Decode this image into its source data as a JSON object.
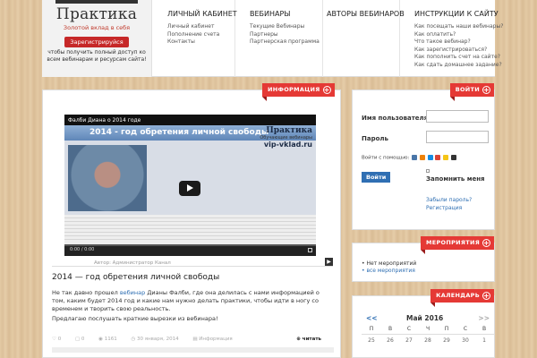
{
  "header": {
    "logo_title": "Практика",
    "logo_subtitle": "Золотой вклад в себя",
    "register_button": "Зарегистрируйся",
    "register_note": "чтобы получить полный доступ ко всем вебинарам и ресурсам сайта!",
    "nav": [
      {
        "title": "ЛИЧНЫЙ КАБИНЕТ",
        "links": [
          "Личный кабинет",
          "Пополнение счета",
          "Контакты"
        ]
      },
      {
        "title": "ВЕБИНАРЫ",
        "links": [
          "Текущие Вебинары",
          "Партнеры",
          "Партнерская программа"
        ]
      },
      {
        "title": "АВТОРЫ ВЕБИНАРОВ",
        "links": []
      },
      {
        "title": "ИНСТРУКЦИИ К САЙТУ",
        "links": [
          "Как посещать наши вебинары?",
          "Как оплатить?",
          "Что такое вебинар?",
          "Как зарегистрироваться?",
          "Как пополнить счет на сайте?",
          "Как сдать домашнее задание?"
        ]
      }
    ]
  },
  "post": {
    "ribbon": "ИНФОРМАЦИЯ",
    "video_title": "Фалби Диана о 2014 годе",
    "slide_heading": "2014 - год обретения личной свободы",
    "slide_brand": "Практика",
    "slide_brand_sub": "Обучающие вебинары",
    "slide_brand_url": "vip-vklad.ru",
    "video_time": "0:00 / 0:00",
    "author": "Автор: Администратор Канал",
    "title": "2014 — год обретения личной свободы",
    "p1_before": "Не так давно прошел ",
    "p1_link": "вебинар",
    "p1_after": " Дианы Фалби, где она делилась с нами информацией о том, каким будет 2014 год и какие нам нужно делать практики, чтобы идти в ногу со временем и творить свою реальность.",
    "p2": "Предлагаю послушать краткие вырезки из вебинара!",
    "meta": {
      "likes": "0",
      "comments": "0",
      "views": "1161",
      "date": "30 января, 2014",
      "category": "Информация",
      "read_more": "читать"
    }
  },
  "sidebar": {
    "login": {
      "ribbon": "ВОЙТИ",
      "username_label": "Имя пользователя",
      "password_label": "Пароль",
      "social_label": "Войти с помощью:",
      "login_button": "Войти",
      "remember": "Запомнить меня",
      "forgot": "Забыли пароль?",
      "register": "Регистрация"
    },
    "events": {
      "ribbon": "МЕРОПРИЯТИЯ",
      "items": [
        "Нет мероприятий",
        "все мероприятия"
      ]
    },
    "calendar": {
      "ribbon": "КАЛЕНДАРЬ",
      "prev": "<<",
      "month": "Май 2016",
      "next": ">>",
      "days": [
        "П",
        "В",
        "С",
        "Ч",
        "П",
        "С",
        "В"
      ],
      "week1": [
        "25",
        "26",
        "27",
        "28",
        "29",
        "30",
        "1"
      ]
    }
  },
  "colors": {
    "accent": "#e53935",
    "link": "#2f6fb3"
  }
}
